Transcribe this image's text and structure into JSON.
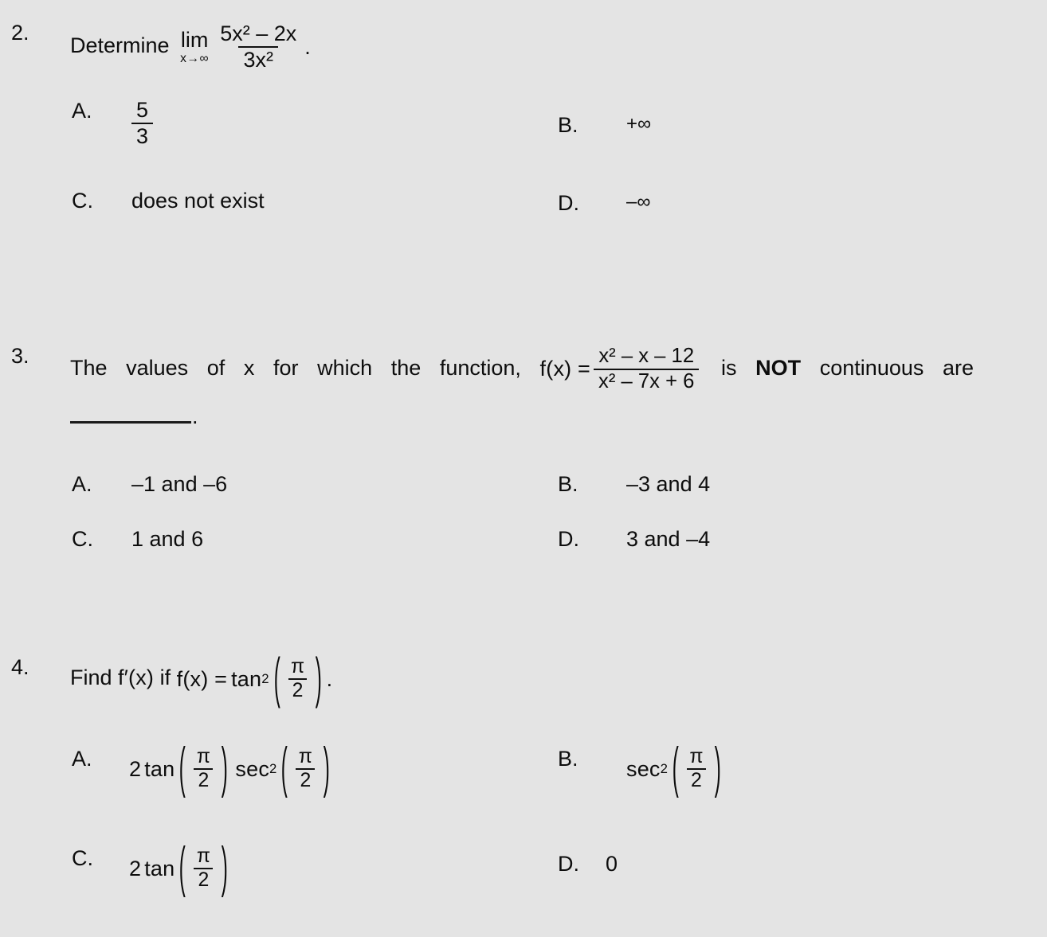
{
  "document": {
    "background_color": "#e4e4e4",
    "text_color": "#0d0d0d"
  },
  "questions": [
    {
      "number": "2.",
      "stem_prefix": "Determine",
      "limit": {
        "operator": "lim",
        "subscript": "x→∞",
        "numerator": "5x² – 2x",
        "denominator": "3x²"
      },
      "trailing_punct": ".",
      "choices": [
        {
          "label": "A.",
          "text": "",
          "kind": "fraction",
          "numerator": "5",
          "denominator": "3"
        },
        {
          "label": "B.",
          "text": "+∞",
          "kind": "text"
        },
        {
          "label": "C.",
          "text": "does not exist",
          "kind": "text"
        },
        {
          "label": "D.",
          "text": "–∞",
          "kind": "text"
        }
      ]
    },
    {
      "number": "3.",
      "stem_part1": "The values of x for which the function,",
      "function_label": "f(x) =",
      "fraction": {
        "numerator": "x² – x – 12",
        "denominator": "x² – 7x + 6"
      },
      "stem_part2_before_bold": "is",
      "stem_bold": "NOT",
      "stem_part2_after_bold": "continuous are",
      "blank_trailing_punct": ".",
      "choices": [
        {
          "label": "A.",
          "text": "–1 and –6",
          "kind": "text"
        },
        {
          "label": "B.",
          "text": "–3  and  4",
          "kind": "text"
        },
        {
          "label": "C.",
          "text": "1 and 6",
          "kind": "text"
        },
        {
          "label": "D.",
          "text": "3  and  –4",
          "kind": "text"
        }
      ]
    },
    {
      "number": "4.",
      "stem_prefix": "Find",
      "derivative": "f′(x)",
      "stem_if": "if",
      "function_label": "f(x) =",
      "trig_base": "tan",
      "trig_exp": "2",
      "arg_numerator": "π",
      "arg_denominator": "2",
      "trailing_punct": ".",
      "choices": [
        {
          "label": "A.",
          "kind": "two-trig",
          "coefficient": "2",
          "first_base": "tan",
          "first_exp": "",
          "first_num": "π",
          "first_den": "2",
          "second_base": "sec",
          "second_exp": "2",
          "second_num": "π",
          "second_den": "2"
        },
        {
          "label": "B.",
          "kind": "one-trig",
          "coefficient": "",
          "base": "sec",
          "exp": "2",
          "num": "π",
          "den": "2"
        },
        {
          "label": "C.",
          "kind": "one-trig",
          "coefficient": "2",
          "base": "tan",
          "exp": "",
          "num": "π",
          "den": "2"
        },
        {
          "label": "D.",
          "kind": "text",
          "text": "0"
        }
      ]
    }
  ]
}
